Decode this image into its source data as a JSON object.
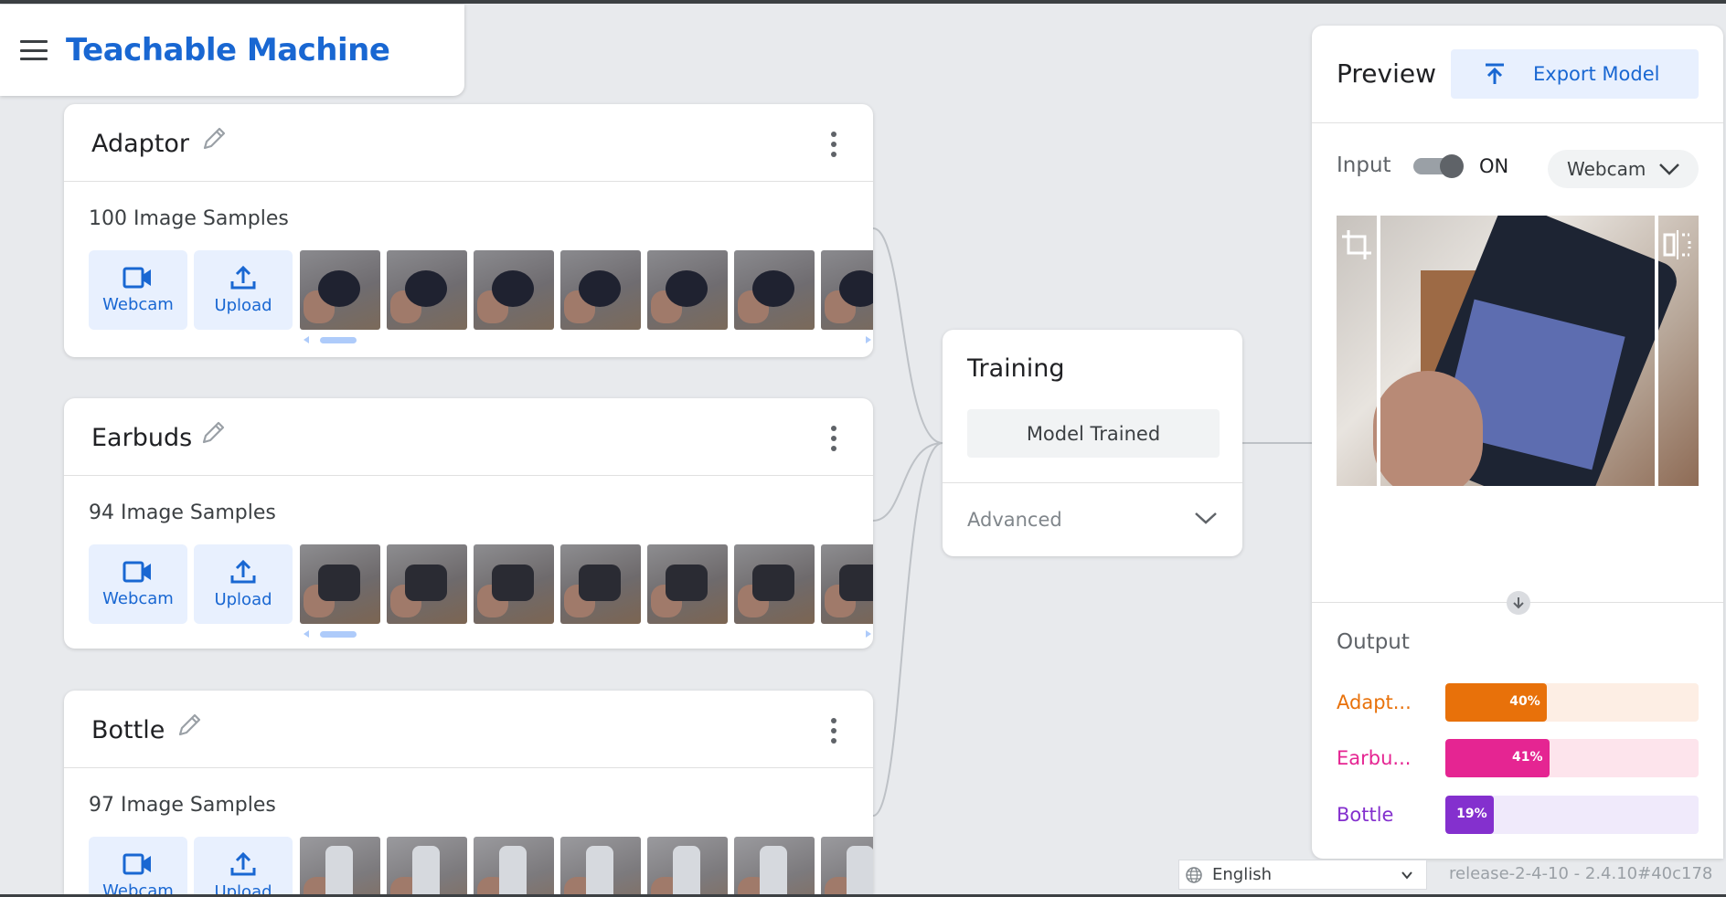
{
  "app": {
    "title": "Teachable Machine"
  },
  "classes": [
    {
      "name": "Adaptor",
      "samples_label": "100 Image Samples",
      "webcam_label": "Webcam",
      "upload_label": "Upload"
    },
    {
      "name": "Earbuds",
      "samples_label": "94 Image Samples",
      "webcam_label": "Webcam",
      "upload_label": "Upload"
    },
    {
      "name": "Bottle",
      "samples_label": "97 Image Samples",
      "webcam_label": "Webcam",
      "upload_label": "Upload"
    }
  ],
  "training": {
    "title": "Training",
    "button_label": "Model Trained",
    "advanced_label": "Advanced"
  },
  "preview": {
    "title": "Preview",
    "export_label": "Export Model",
    "input_label": "Input",
    "toggle_state": "ON",
    "source": "Webcam",
    "output_label": "Output",
    "outputs": [
      {
        "name": "Adapt...",
        "percent": 40,
        "percent_label": "40%",
        "color": "#e8710a",
        "track": "#fdeee4"
      },
      {
        "name": "Earbu...",
        "percent": 41,
        "percent_label": "41%",
        "color": "#e52592",
        "track": "#fde4ec"
      },
      {
        "name": "Bottle",
        "percent": 19,
        "percent_label": "19%",
        "color": "#8430ce",
        "track": "#f0eafb"
      }
    ]
  },
  "footer": {
    "language": "English",
    "release": "release-2-4-10 - 2.4.10#40c178"
  },
  "icons": [
    "menu-icon",
    "pencil-icon",
    "more-vert-icon",
    "videocam-icon",
    "upload-icon",
    "chevron-down-icon",
    "export-icon",
    "crop-icon",
    "flip-icon",
    "arrow-down-icon",
    "globe-icon"
  ]
}
